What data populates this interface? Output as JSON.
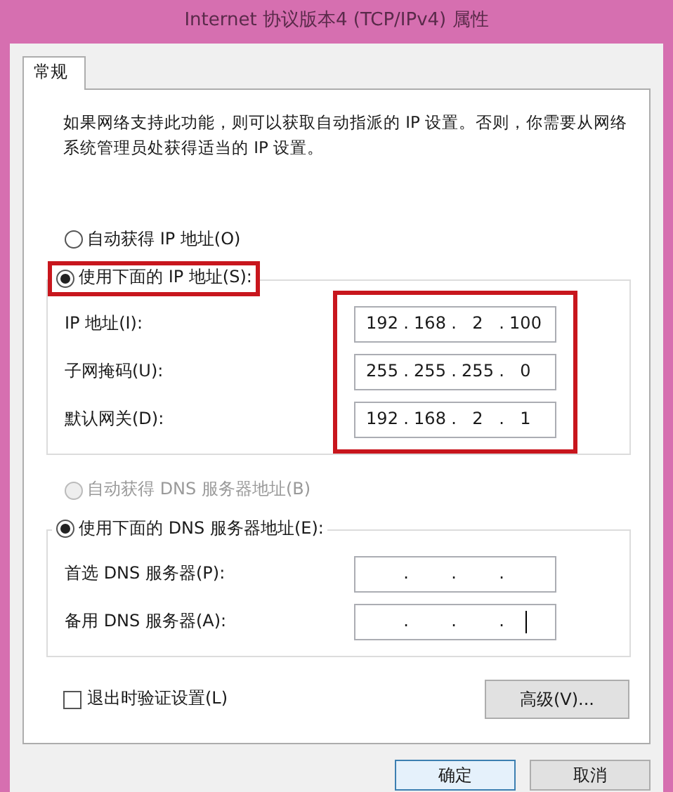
{
  "window": {
    "title": "Internet 协议版本4 (TCP/IPv4) 属性"
  },
  "tabs": [
    {
      "label": "常规",
      "selected": true
    }
  ],
  "description": "如果网络支持此功能，则可以获取自动指派的 IP 设置。否则，你需要从网络系统管理员处获得适当的 IP 设置。",
  "ip_section": {
    "options": [
      {
        "label": "自动获得 IP 地址(O)",
        "selected": false,
        "disabled": false,
        "highlighted": false
      },
      {
        "label": "使用下面的 IP 地址(S):",
        "selected": true,
        "disabled": false,
        "highlighted": true
      }
    ],
    "fields_highlighted": true,
    "fields": [
      {
        "label": "IP 地址(I):",
        "octets": [
          "192",
          "168",
          "2",
          "100"
        ],
        "dots": [
          ".",
          ".",
          "."
        ]
      },
      {
        "label": "子网掩码(U):",
        "octets": [
          "255",
          "255",
          "255",
          "0"
        ],
        "dots": [
          ".",
          ".",
          "."
        ]
      },
      {
        "label": "默认网关(D):",
        "octets": [
          "192",
          "168",
          "2",
          "1"
        ],
        "dots": [
          ".",
          ".",
          "."
        ]
      }
    ]
  },
  "dns_section": {
    "options": [
      {
        "label": "自动获得 DNS 服务器地址(B)",
        "selected": false,
        "disabled": true,
        "highlighted": false
      },
      {
        "label": "使用下面的 DNS 服务器地址(E):",
        "selected": true,
        "disabled": false,
        "highlighted": false
      }
    ],
    "fields_highlighted": false,
    "fields": [
      {
        "label": "首选 DNS 服务器(P):",
        "dots": [
          ".",
          ".",
          "."
        ],
        "caret": false
      },
      {
        "label": "备用 DNS 服务器(A):",
        "dots": [
          ".",
          ".",
          "."
        ],
        "caret": true
      }
    ]
  },
  "validate": {
    "label": "退出时验证设置(L)",
    "checked": false
  },
  "advanced_button": "高级(V)...",
  "buttons": [
    {
      "label": "确定",
      "kind": "default"
    },
    {
      "label": "取消",
      "kind": "normal"
    }
  ]
}
